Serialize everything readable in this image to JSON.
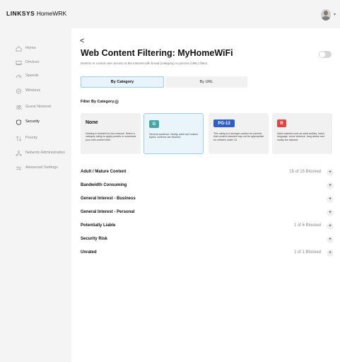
{
  "header": {
    "brand": "LINKSYS",
    "product": "HomeWRK"
  },
  "sidebar": {
    "items": [
      {
        "label": "Home",
        "icon": "home-icon"
      },
      {
        "label": "Devices",
        "icon": "devices-icon"
      },
      {
        "label": "Speeds",
        "icon": "speedometer-icon"
      },
      {
        "label": "Wireless",
        "icon": "wireless-icon"
      },
      {
        "label": "Guest Network",
        "icon": "guest-network-icon"
      },
      {
        "label": "Security",
        "icon": "shield-icon",
        "active": true
      },
      {
        "label": "Priority",
        "icon": "priority-arrows-icon"
      },
      {
        "label": "Network Administration",
        "icon": "network-admin-icon"
      },
      {
        "label": "Advanced Settings",
        "icon": "sliders-icon"
      }
    ]
  },
  "page": {
    "back": "<",
    "title": "Web Content Filtering: MyHomeWiFi",
    "subtitle": "Restrict or control user access to the internet with broad (category) or precise (URL) filters.",
    "toggle_on": false
  },
  "tabs": {
    "by_category": "By Category",
    "by_url": "By URL"
  },
  "filter": {
    "label": "Filter By Category",
    "info": "i"
  },
  "cards": [
    {
      "label": "None",
      "color": "",
      "desc": "Nothing is blocked for this network. Select a category rating to apply presets or customize your web content filter."
    },
    {
      "label": "G",
      "color": "#4aa6a6",
      "desc": "General audience. Nudity, adult and mature topics, violence are blocked."
    },
    {
      "label": "PG-13",
      "color": "#2f5fc2",
      "desc": "This rating is a stronger caution for parents that content included may not be appropriate for children under 13"
    },
    {
      "label": "R",
      "color": "#e04545",
      "desc": "Adult material such as adult activity, harsh language, some violence, drug abuse and nudity are allowed."
    }
  ],
  "categories": [
    {
      "name": "Adult / Mature Content",
      "count": "15 of 15 Blocked"
    },
    {
      "name": "Bandwidth Consuming",
      "count": ""
    },
    {
      "name": "General Interest - Business",
      "count": ""
    },
    {
      "name": "General Interest - Personal",
      "count": ""
    },
    {
      "name": "Potentially Liable",
      "count": "1 of 6 Blocked"
    },
    {
      "name": "Security Risk",
      "count": ""
    },
    {
      "name": "Unrated",
      "count": "1 of 1 Blocked"
    }
  ],
  "plus": "+"
}
